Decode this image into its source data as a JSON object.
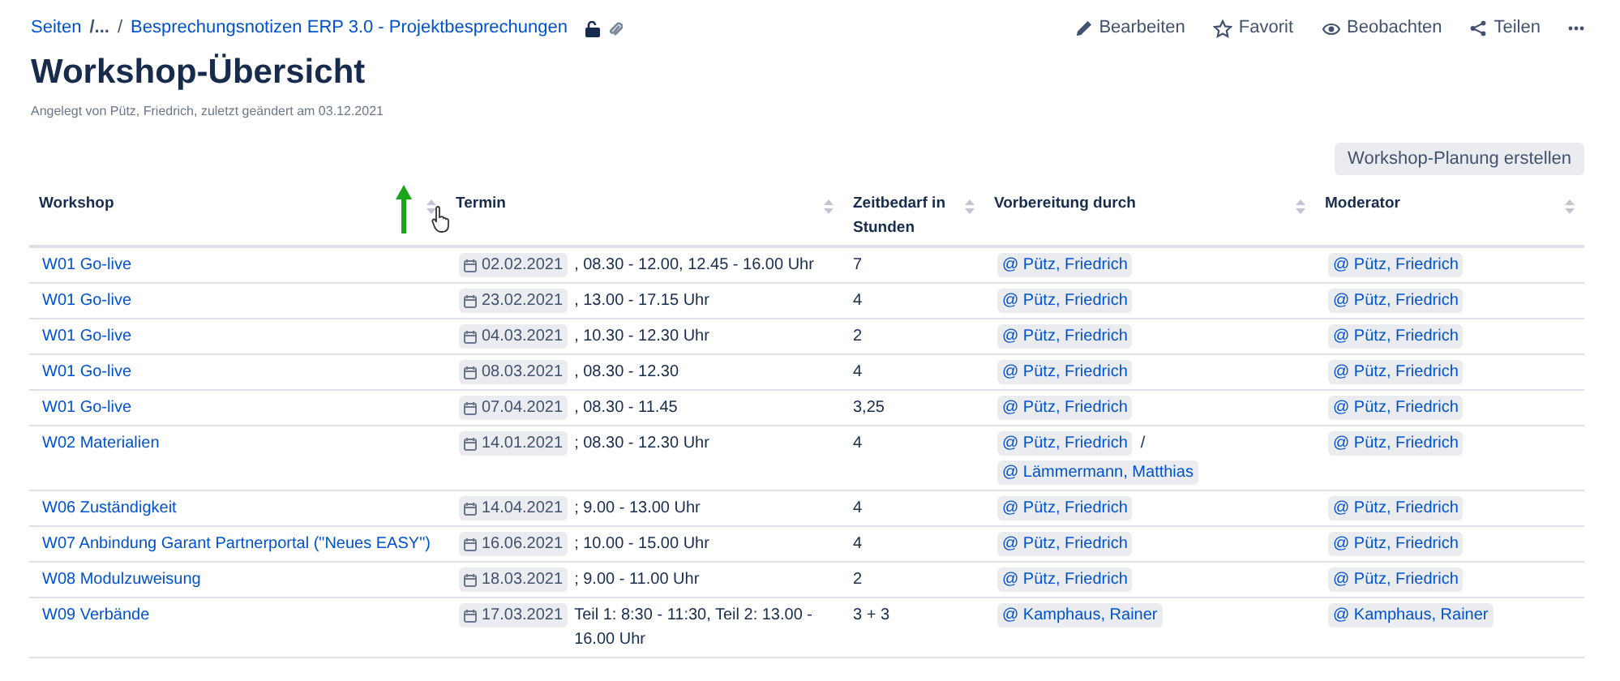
{
  "breadcrumb": {
    "items": [
      "Seiten",
      "/...",
      "/",
      "Besprechungsnotizen ERP 3.0 - Projektbesprechungen"
    ]
  },
  "actions": [
    {
      "kind": "edit",
      "label": "Bearbeiten"
    },
    {
      "kind": "star",
      "label": "Favorit"
    },
    {
      "kind": "watch",
      "label": "Beobachten"
    },
    {
      "kind": "share",
      "label": "Teilen"
    }
  ],
  "title": "Workshop-Übersicht",
  "byline": "Angelegt von Pütz, Friedrich, zuletzt geändert am 03.12.2021",
  "create_button": "Workshop-Planung erstellen",
  "table": {
    "columns": [
      "Workshop",
      "Termin",
      "Zeitbedarf in Stunden",
      "Vorbereitung durch",
      "Moderator"
    ],
    "rows": [
      {
        "workshop": "W01 Go-live",
        "date": "02.02.2021",
        "time": ", 08.30 - 12.00, 12.45 - 16.00 Uhr",
        "hours": "7",
        "prep": [
          "@ Pütz, Friedrich"
        ],
        "moderator": [
          "@ Pütz, Friedrich"
        ]
      },
      {
        "workshop": "W01 Go-live",
        "date": "23.02.2021",
        "time": ", 13.00 - 17.15 Uhr",
        "hours": "4",
        "prep": [
          "@ Pütz, Friedrich"
        ],
        "moderator": [
          "@ Pütz, Friedrich"
        ]
      },
      {
        "workshop": "W01 Go-live",
        "date": "04.03.2021",
        "time": ", 10.30 - 12.30 Uhr",
        "hours": "2",
        "prep": [
          "@ Pütz, Friedrich"
        ],
        "moderator": [
          "@ Pütz, Friedrich"
        ]
      },
      {
        "workshop": "W01 Go-live",
        "date": "08.03.2021",
        "time": ", 08.30 - 12.30",
        "hours": "4",
        "prep": [
          "@ Pütz, Friedrich"
        ],
        "moderator": [
          "@ Pütz, Friedrich"
        ]
      },
      {
        "workshop": "W01 Go-live",
        "date": "07.04.2021",
        "time": ", 08.30 - 11.45",
        "hours": "3,25",
        "prep": [
          "@ Pütz, Friedrich"
        ],
        "moderator": [
          "@ Pütz, Friedrich"
        ]
      },
      {
        "workshop": "W02 Materialien",
        "date": "14.01.2021",
        "time": "; 08.30 - 12.30 Uhr",
        "hours": "4",
        "prep": [
          "@ Pütz, Friedrich",
          "/",
          "@ Lämmermann, Matthias"
        ],
        "moderator": [
          "@ Pütz, Friedrich"
        ]
      },
      {
        "workshop": "W06 Zuständigkeit",
        "date": "14.04.2021",
        "time": "; 9.00 - 13.00 Uhr",
        "hours": "4",
        "prep": [
          "@ Pütz, Friedrich"
        ],
        "moderator": [
          "@ Pütz, Friedrich"
        ]
      },
      {
        "workshop": "W07 Anbindung Garant Partnerportal (\"Neues EASY\")",
        "date": "16.06.2021",
        "time": "; 10.00 - 15.00 Uhr",
        "hours": "4",
        "prep": [
          "@ Pütz, Friedrich"
        ],
        "moderator": [
          "@ Pütz, Friedrich"
        ]
      },
      {
        "workshop": "W08 Modulzuweisung",
        "date": "18.03.2021",
        "time": "; 9.00 - 11.00 Uhr",
        "hours": "2",
        "prep": [
          "@ Pütz, Friedrich"
        ],
        "moderator": [
          "@ Pütz, Friedrich"
        ]
      },
      {
        "workshop": "W09 Verbände",
        "date": "17.03.2021",
        "time": "Teil 1: 8:30 - 11:30, Teil 2: 13.00 - 16.00 Uhr",
        "hours": "3 + 3",
        "prep": [
          "@ Kamphaus, Rainer"
        ],
        "moderator": [
          "@ Kamphaus, Rainer"
        ]
      }
    ]
  }
}
